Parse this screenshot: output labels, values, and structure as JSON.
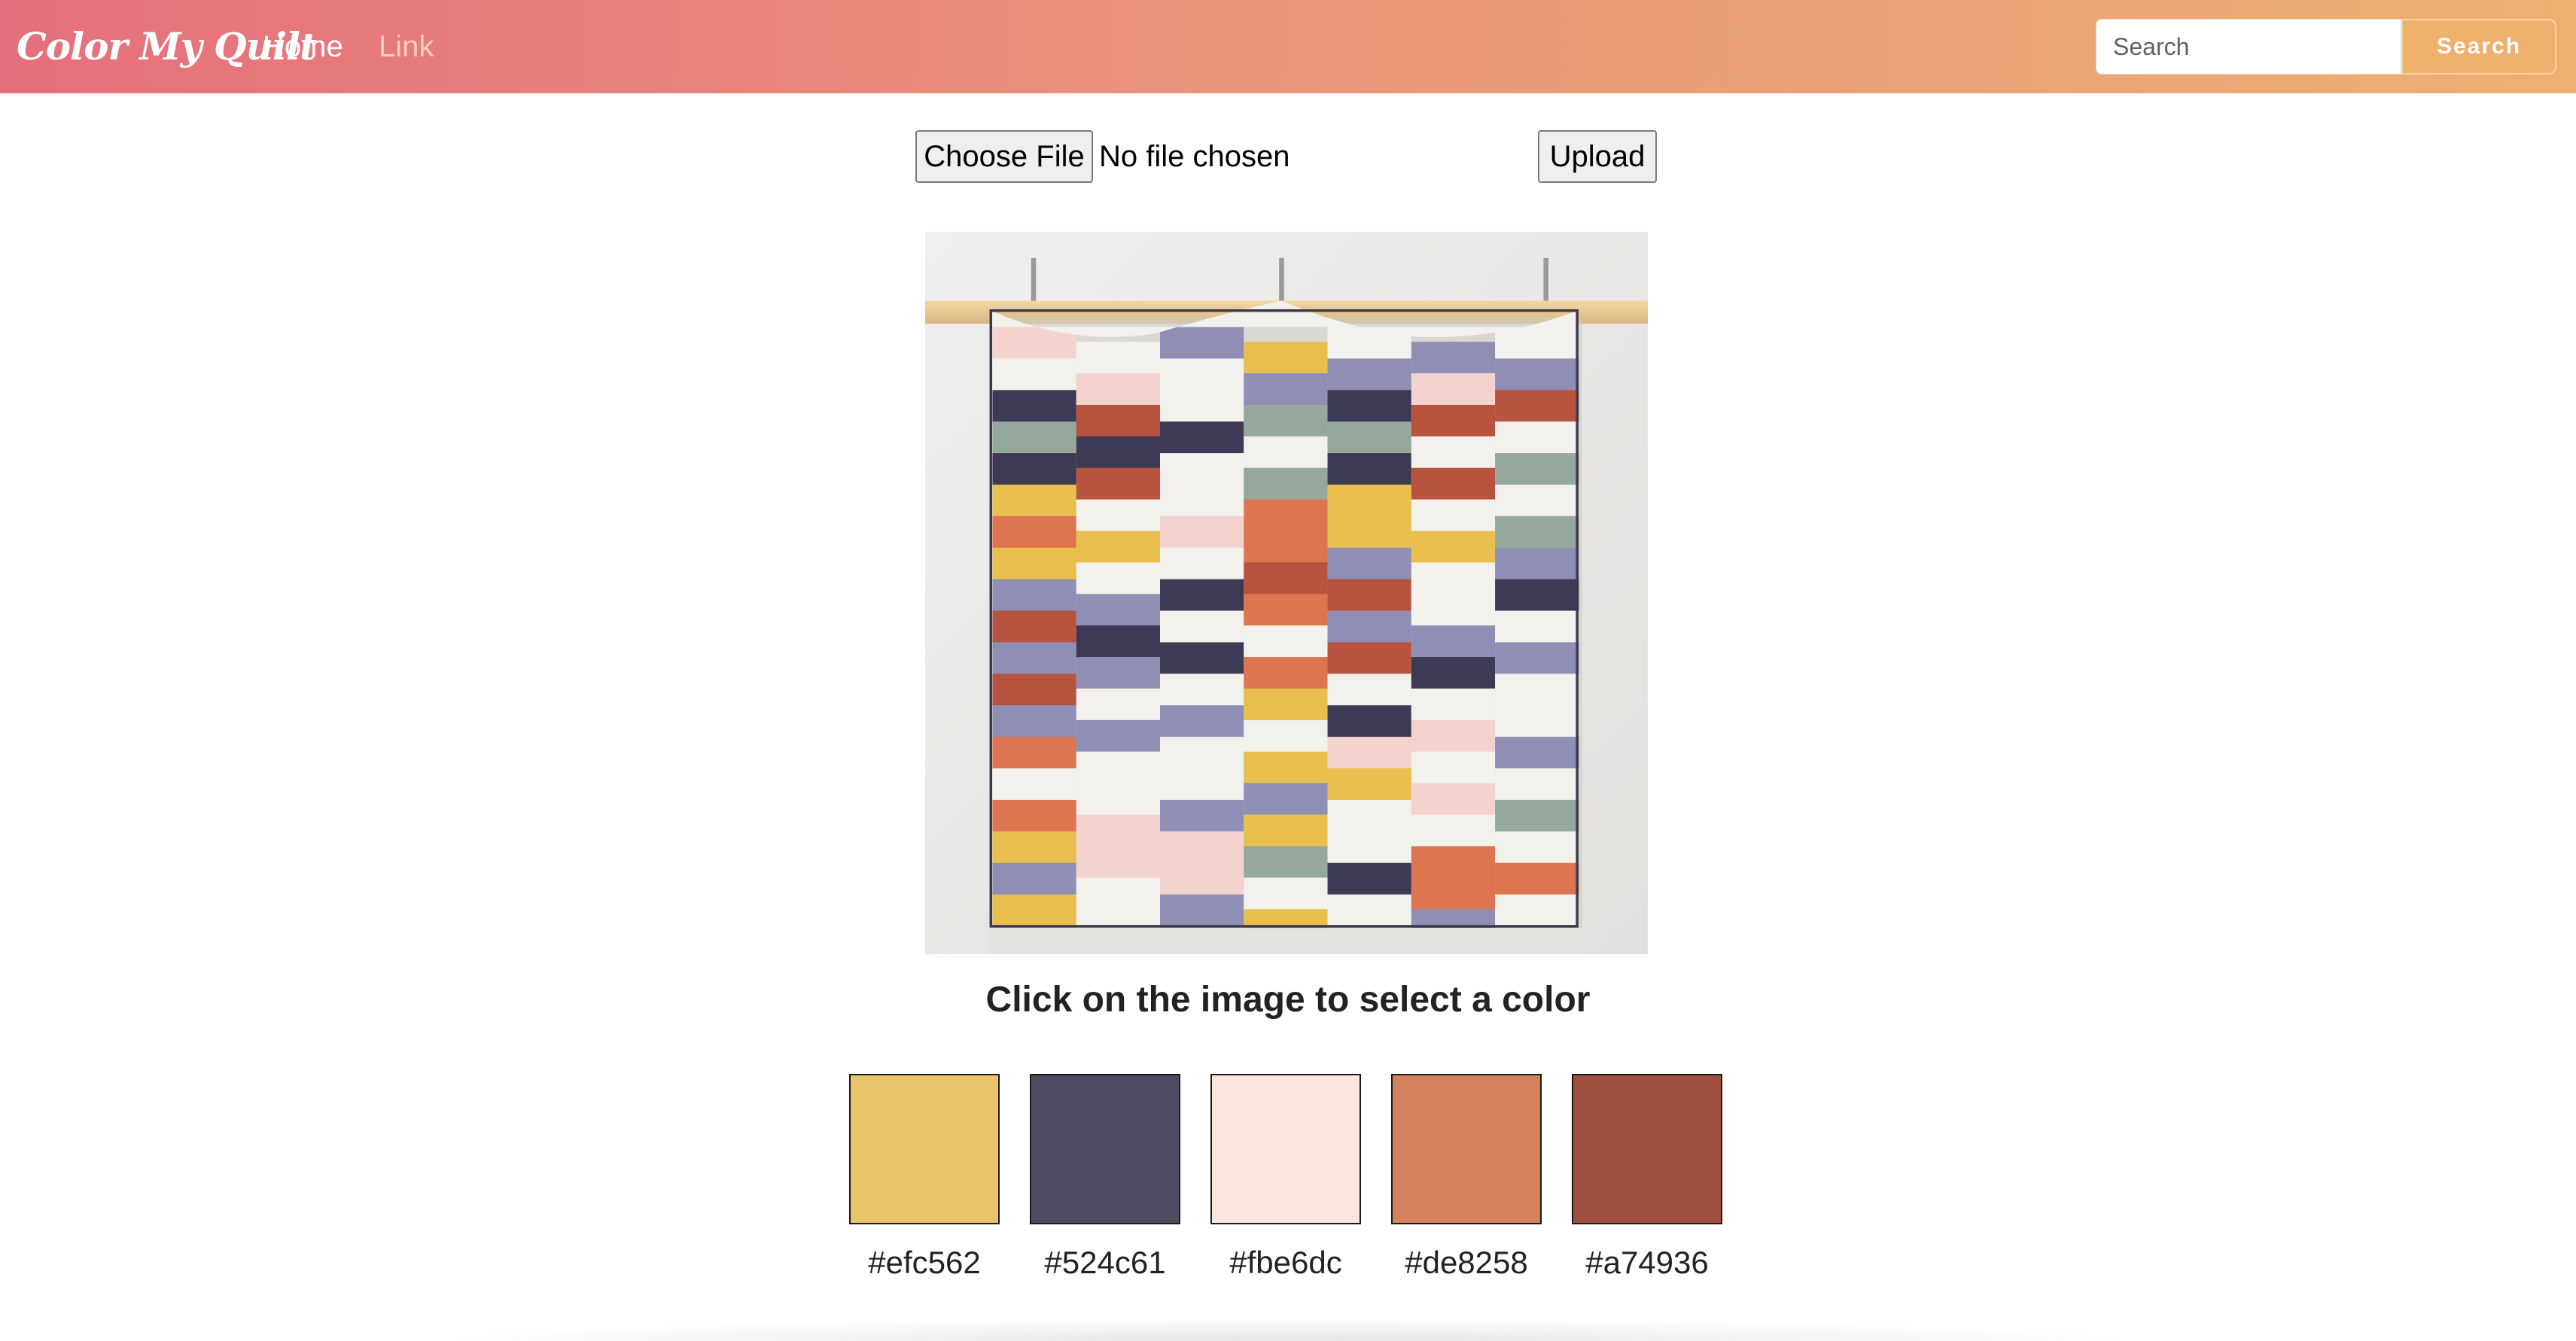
{
  "navbar": {
    "brand": "Color My Quilt",
    "links": [
      {
        "label": "Home"
      },
      {
        "label": "Link"
      }
    ],
    "search": {
      "placeholder": "Search",
      "value": "",
      "button_label": "Search"
    },
    "colors": {
      "gradient_start": "#e56f7c",
      "gradient_end": "#edb071"
    }
  },
  "upload_form": {
    "choose_label": "Choose File",
    "file_status": "No file chosen",
    "upload_label": "Upload"
  },
  "main": {
    "image_icon": "quilt-photo",
    "instruction": "Click on the image to select a color"
  },
  "palette": [
    {
      "hex": "#efc562",
      "display": "#e8c56b"
    },
    {
      "hex": "#524c61",
      "display": "#4e4a5f"
    },
    {
      "hex": "#fbe6dc",
      "display": "#f9e6dd"
    },
    {
      "hex": "#de8258",
      "display": "#d4825e"
    },
    {
      "hex": "#a74936",
      "display": "#9f4f3d"
    }
  ]
}
